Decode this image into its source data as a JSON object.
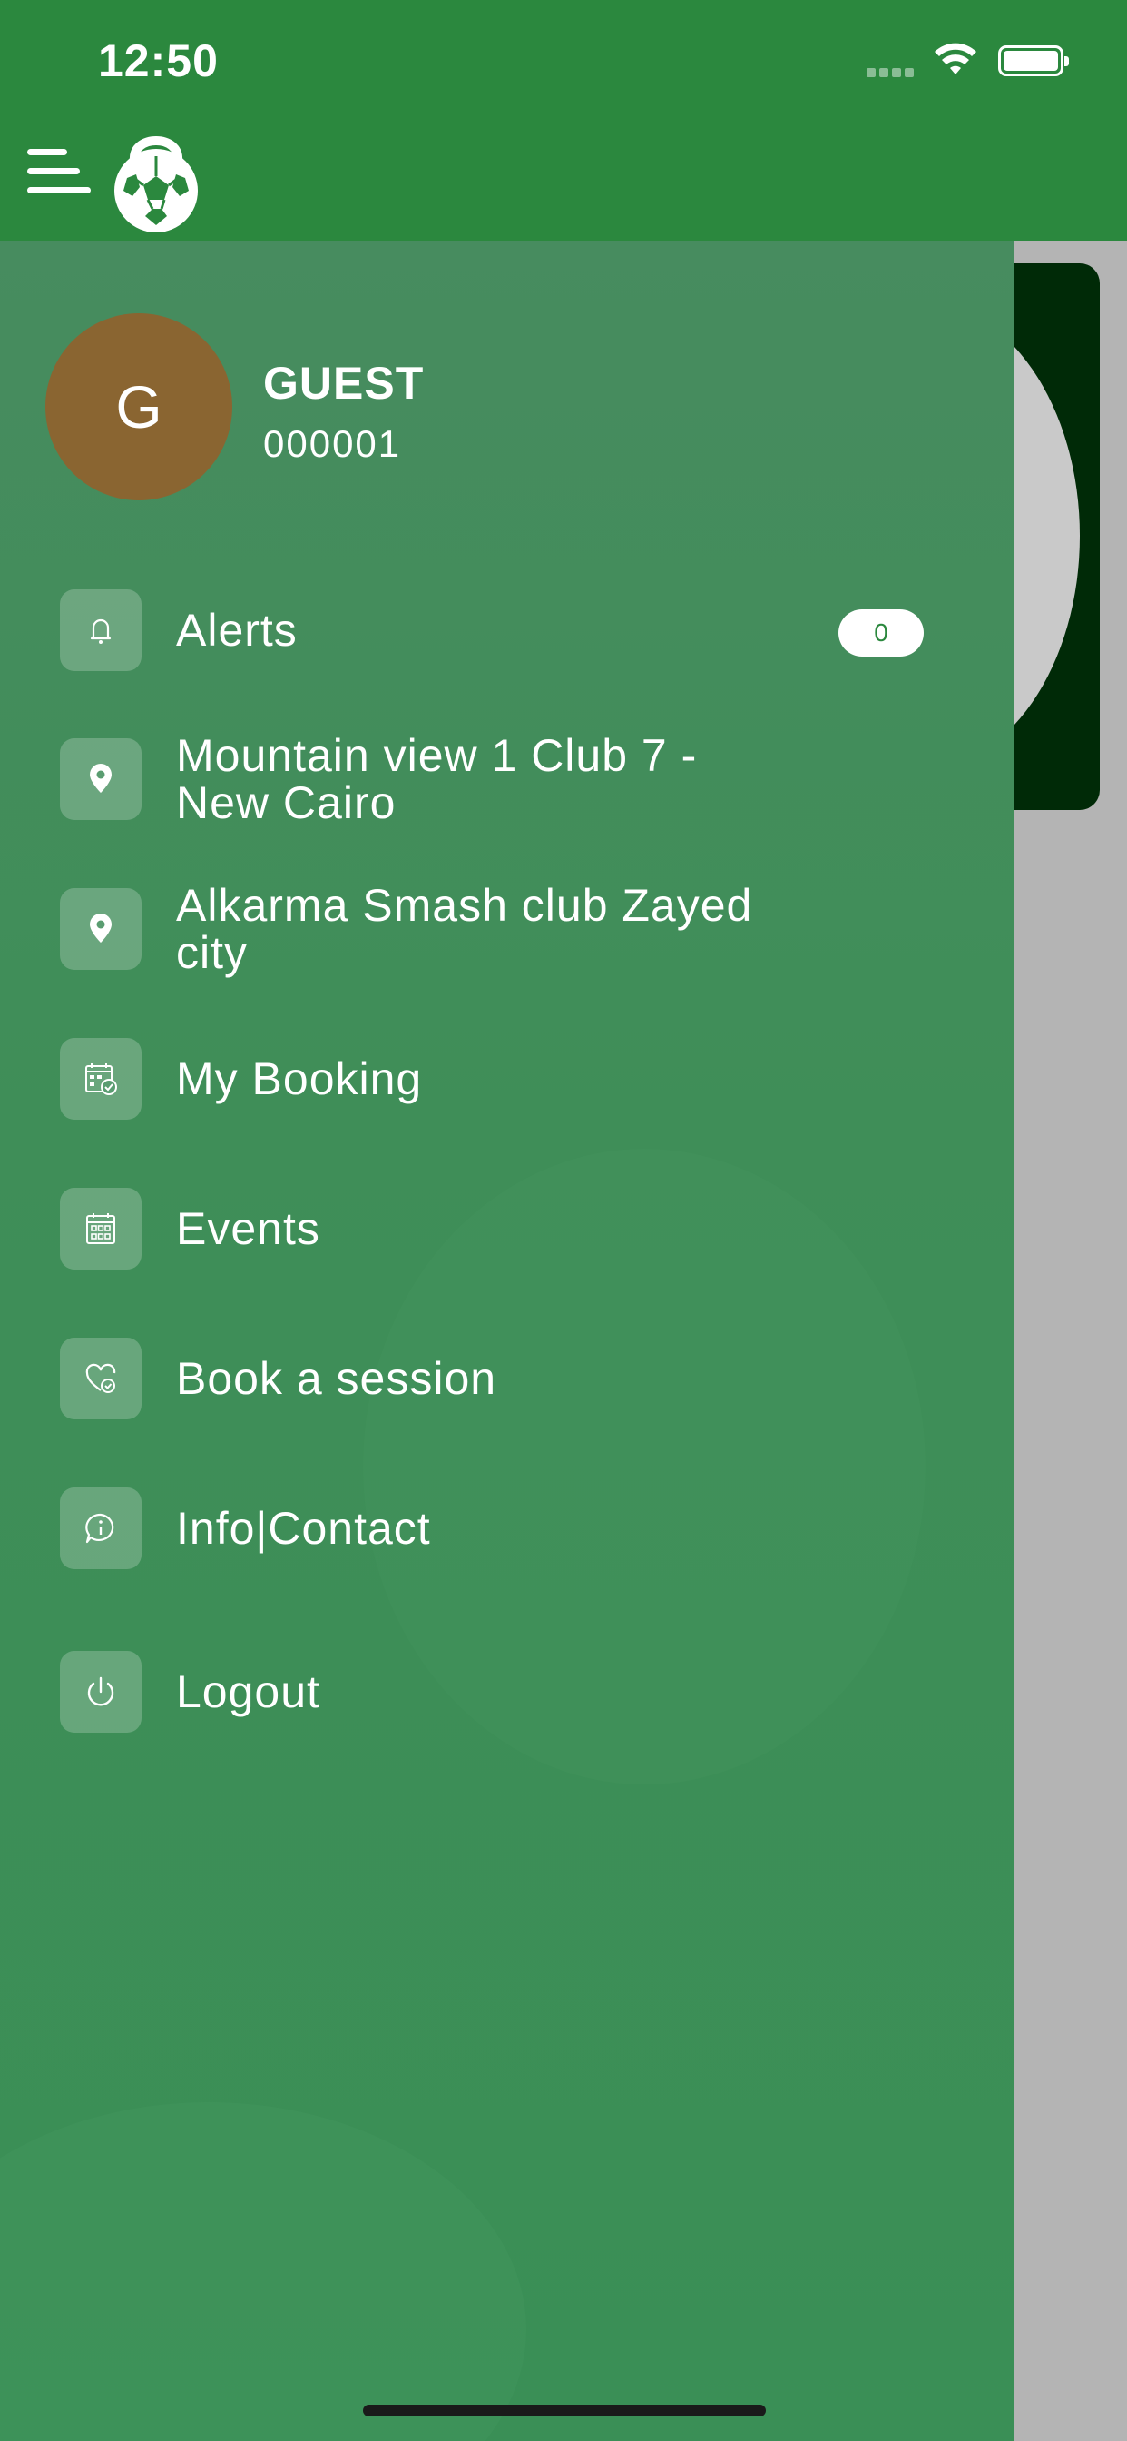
{
  "status_bar": {
    "time": "12:50"
  },
  "user": {
    "initial": "G",
    "name": "GUEST",
    "id": "000001"
  },
  "menu": {
    "alerts": {
      "label": "Alerts",
      "badge": "0"
    },
    "location1": {
      "label": "Mountain view 1 Club 7 - New Cairo"
    },
    "location2": {
      "label": "Alkarma Smash club Zayed city"
    },
    "my_booking": {
      "label": "My Booking"
    },
    "events": {
      "label": "Events"
    },
    "book_session": {
      "label": "Book a session"
    },
    "info_contact": {
      "label": "Info|Contact"
    },
    "logout": {
      "label": "Logout"
    }
  },
  "colors": {
    "topbar": "#2b883e",
    "drawer": "#428e5b",
    "avatar": "#8a6531",
    "badge_text": "#2b883e"
  },
  "icons": [
    "menu-icon",
    "kettlebell-football-logo",
    "bell-icon",
    "location-pin-icon",
    "calendar-check-icon",
    "calendar-grid-icon",
    "heart-check-icon",
    "info-chat-icon",
    "power-icon"
  ]
}
